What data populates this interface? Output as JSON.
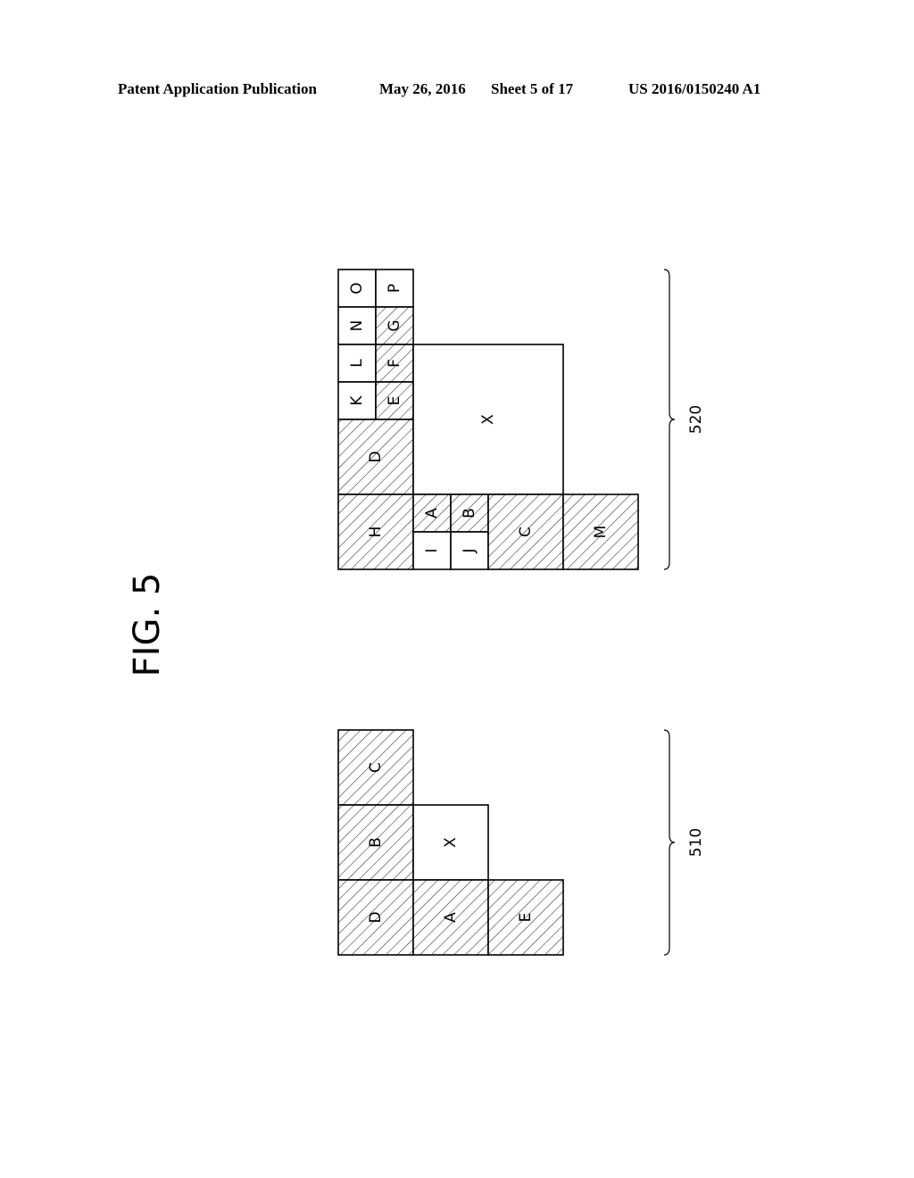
{
  "header": {
    "left": "Patent Application Publication",
    "date": "May 26, 2016",
    "sheet": "Sheet 5 of 17",
    "number": "US 2016/0150240 A1"
  },
  "figure": {
    "title": "FIG. 5"
  },
  "diagrams": [
    {
      "ref": "520",
      "cells": [
        {
          "label": "O",
          "hatched": false,
          "c": 0,
          "r": 0,
          "w": 1,
          "h": 1
        },
        {
          "label": "P",
          "hatched": false,
          "c": 1,
          "r": 0,
          "w": 1,
          "h": 1
        },
        {
          "label": "N",
          "hatched": false,
          "c": 0,
          "r": 1,
          "w": 1,
          "h": 1
        },
        {
          "label": "G",
          "hatched": true,
          "c": 1,
          "r": 1,
          "w": 1,
          "h": 1
        },
        {
          "label": "L",
          "hatched": false,
          "c": 0,
          "r": 2,
          "w": 1,
          "h": 1
        },
        {
          "label": "F",
          "hatched": true,
          "c": 1,
          "r": 2,
          "w": 1,
          "h": 1
        },
        {
          "label": "K",
          "hatched": false,
          "c": 0,
          "r": 3,
          "w": 1,
          "h": 1
        },
        {
          "label": "E",
          "hatched": true,
          "c": 1,
          "r": 3,
          "w": 1,
          "h": 1
        },
        {
          "label": "D",
          "hatched": true,
          "c": 0,
          "r": 4,
          "w": 2,
          "h": 2
        },
        {
          "label": "X",
          "hatched": false,
          "c": 2,
          "r": 2,
          "w": 4,
          "h": 4
        },
        {
          "label": "H",
          "hatched": true,
          "c": 0,
          "r": 6,
          "w": 2,
          "h": 2
        },
        {
          "label": "A",
          "hatched": true,
          "c": 2,
          "r": 6,
          "w": 1,
          "h": 1
        },
        {
          "label": "B",
          "hatched": true,
          "c": 3,
          "r": 6,
          "w": 1,
          "h": 1
        },
        {
          "label": "I",
          "hatched": false,
          "c": 2,
          "r": 7,
          "w": 1,
          "h": 1
        },
        {
          "label": "J",
          "hatched": false,
          "c": 3,
          "r": 7,
          "w": 1,
          "h": 1
        },
        {
          "label": "C",
          "hatched": true,
          "c": 4,
          "r": 6,
          "w": 2,
          "h": 2
        },
        {
          "label": "M",
          "hatched": true,
          "c": 6,
          "r": 6,
          "w": 2,
          "h": 2
        }
      ]
    },
    {
      "ref": "510",
      "cells": [
        {
          "label": "C",
          "hatched": true,
          "c": 0,
          "r": 0,
          "w": 2,
          "h": 2
        },
        {
          "label": "B",
          "hatched": true,
          "c": 0,
          "r": 2,
          "w": 2,
          "h": 2
        },
        {
          "label": "X",
          "hatched": false,
          "c": 2,
          "r": 2,
          "w": 2,
          "h": 2
        },
        {
          "label": "D",
          "hatched": true,
          "c": 0,
          "r": 4,
          "w": 2,
          "h": 2
        },
        {
          "label": "A",
          "hatched": true,
          "c": 2,
          "r": 4,
          "w": 2,
          "h": 2
        },
        {
          "label": "E",
          "hatched": true,
          "c": 4,
          "r": 4,
          "w": 2,
          "h": 2
        }
      ]
    }
  ]
}
